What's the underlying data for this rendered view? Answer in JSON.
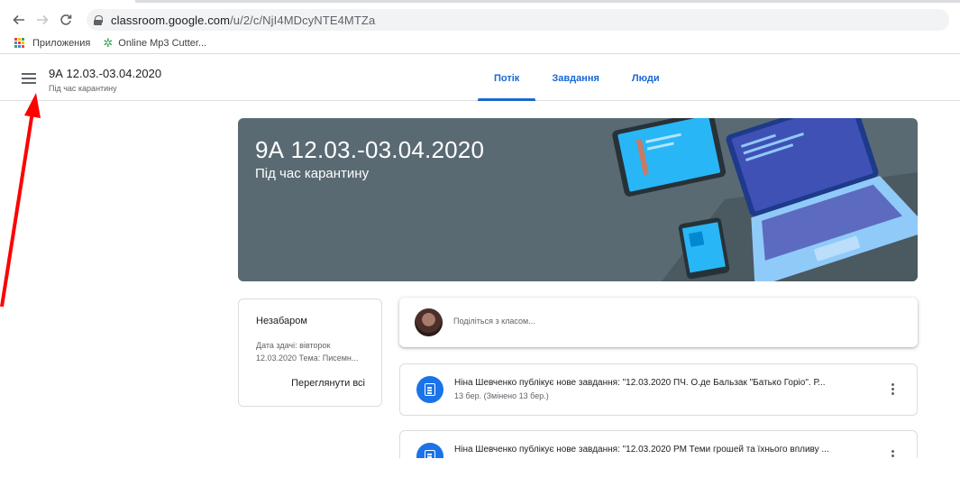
{
  "browser": {
    "url_host": "classroom.google.com",
    "url_path": "/u/2/c/NjI4MDcyNTE4MTZa",
    "back_icon": "arrow-left-icon",
    "forward_icon": "arrow-right-icon",
    "reload_icon": "reload-icon",
    "bookmarks": [
      {
        "label": "Приложения",
        "icon": "apps-grid-icon"
      },
      {
        "label": "Online Mp3 Cutter...",
        "icon": "leaf-icon"
      }
    ]
  },
  "header": {
    "class_title": "9А 12.03.-03.04.2020",
    "class_subtitle": "Під час карантину",
    "tabs": [
      {
        "label": "Потік",
        "active": true
      },
      {
        "label": "Завдання",
        "active": false
      },
      {
        "label": "Люди",
        "active": false
      }
    ]
  },
  "banner": {
    "title": "9А 12.03.-03.04.2020",
    "subtitle": "Під час карантину"
  },
  "upcoming": {
    "title": "Незабаром",
    "line1": "Дата здачі: вівторок",
    "line2": "12.03.2020 Тема: Писемн...",
    "view_all": "Переглянути всі"
  },
  "share": {
    "placeholder": "Поділіться з класом..."
  },
  "posts": [
    {
      "title": "Ніна Шевченко публікує нове завдання: \"12.03.2020 ПЧ. О.де Бальзак \"Батько Горіо\". Р...",
      "meta": "13 бер. (Змінено 13 бер.)"
    },
    {
      "title": "Ніна Шевченко публікує нове завдання: \"12.03.2020 РМ Теми грошей та їхнього впливу ...",
      "meta": ""
    }
  ],
  "colors": {
    "accent": "#1967d2",
    "banner_bg": "#5a6a73",
    "post_icon": "#1a73e8",
    "annotation_arrow": "#ff0000"
  }
}
